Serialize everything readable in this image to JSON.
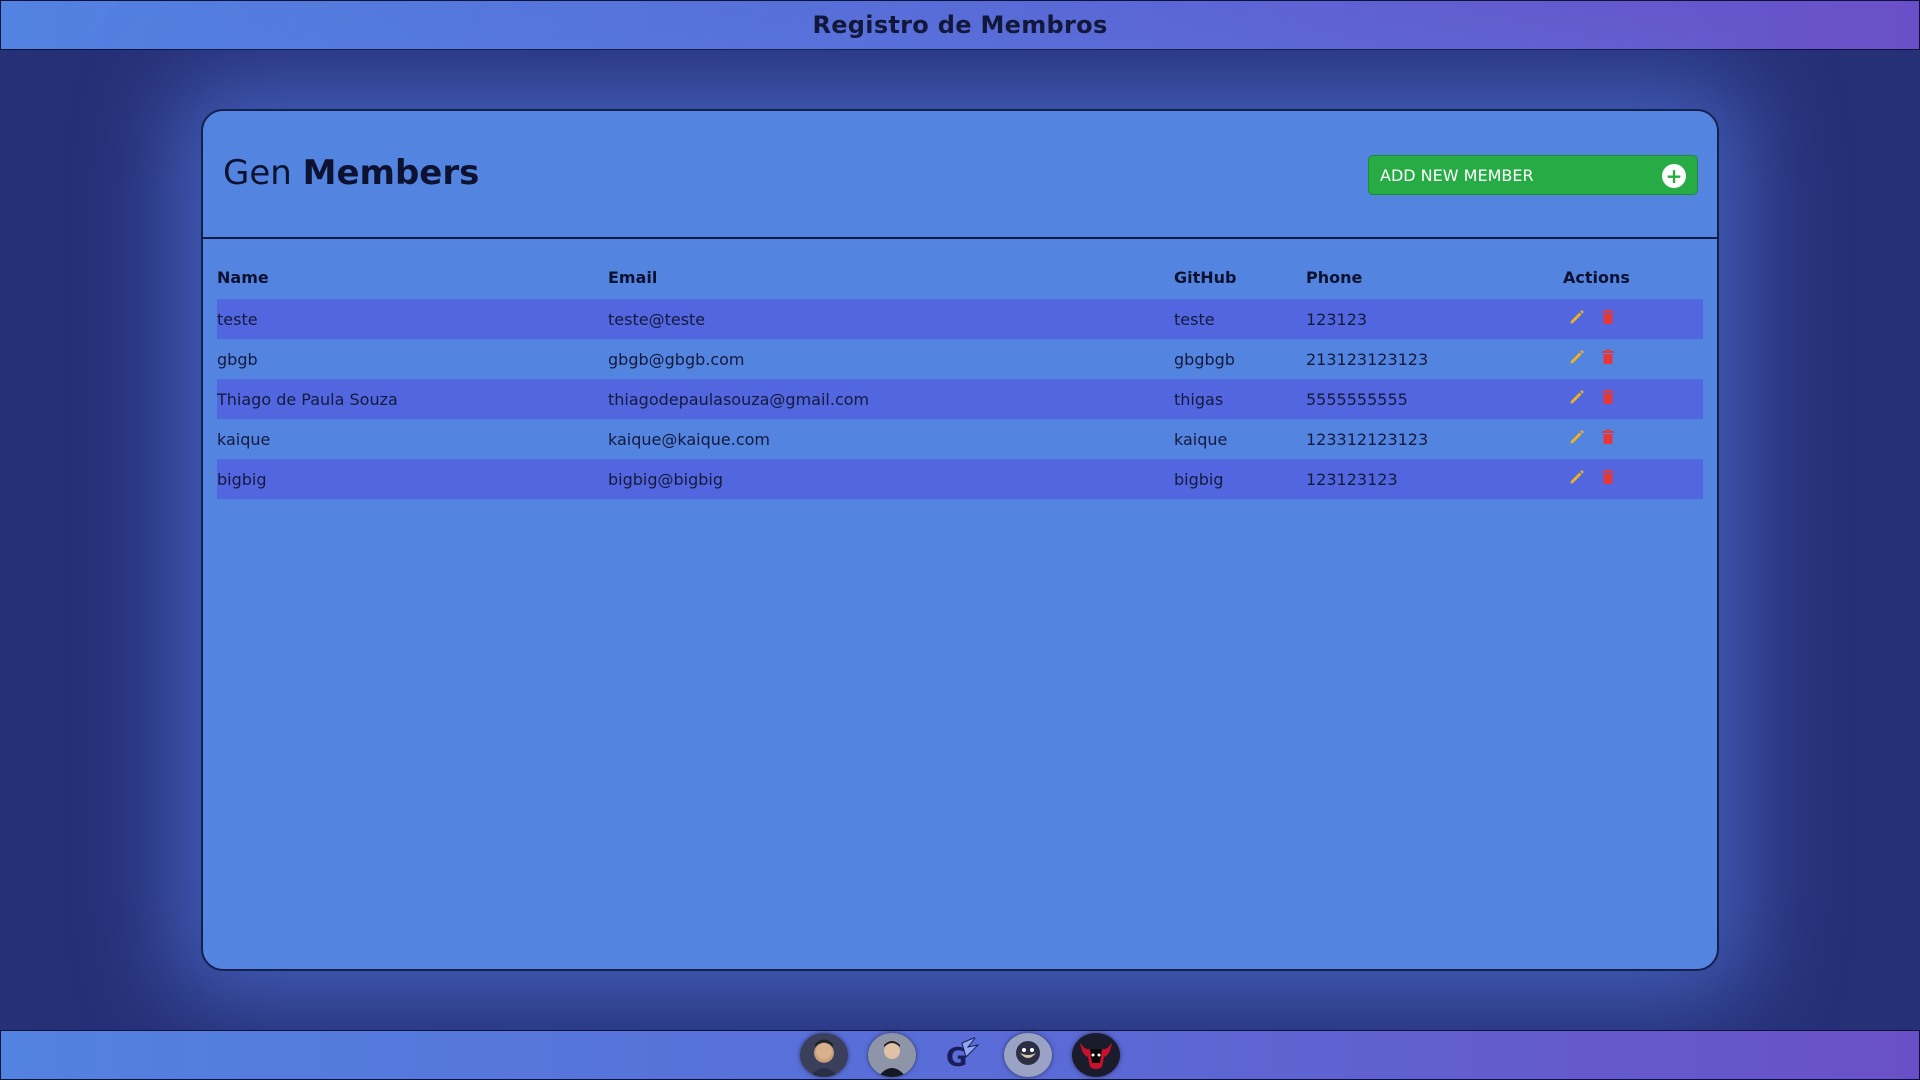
{
  "header": {
    "title": "Registro de Membros"
  },
  "panel": {
    "title_light": "Gen",
    "title_bold": "Members",
    "add_button_label": "ADD NEW MEMBER"
  },
  "table": {
    "headers": {
      "name": "Name",
      "email": "Email",
      "github": "GitHub",
      "phone": "Phone",
      "actions": "Actions"
    },
    "rows": [
      {
        "name": "teste",
        "email": "teste@teste",
        "github": "teste",
        "phone": "123123"
      },
      {
        "name": "gbgb",
        "email": "gbgb@gbgb.com",
        "github": "gbgbgb",
        "phone": "213123123123"
      },
      {
        "name": "Thiago de Paula Souza",
        "email": "thiagodepaulasouza@gmail.com",
        "github": "thigas",
        "phone": "5555555555"
      },
      {
        "name": "kaique",
        "email": "kaique@kaique.com",
        "github": "kaique",
        "phone": "123312123123"
      },
      {
        "name": "bigbig",
        "email": "bigbig@bigbig",
        "github": "bigbig",
        "phone": "123123123"
      }
    ]
  },
  "footer": {
    "avatars": [
      "avatar-1",
      "avatar-2",
      "gen-logo",
      "avatar-4",
      "bull-logo"
    ]
  },
  "colors": {
    "background": "#263077",
    "panel": "#5384e0",
    "row_alt": "#5266e0",
    "add_button": "#27ac45",
    "edit_icon": "#f2b21b",
    "delete_icon": "#e5383b"
  }
}
